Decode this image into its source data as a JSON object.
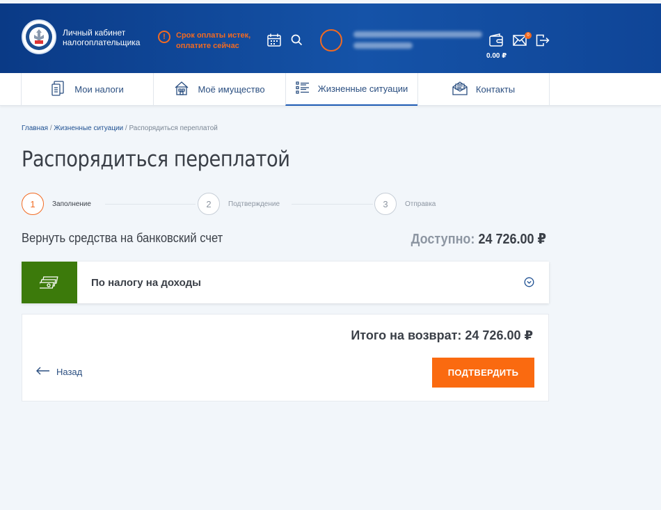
{
  "header": {
    "logo_title": "Личный кабинет налогоплательщика",
    "alert_text": "Срок оплаты истек, оплатите сейчас",
    "alert_icon": "!",
    "wallet_amount": "0.00 ₽",
    "mail_badge": "0"
  },
  "nav": {
    "items": [
      {
        "label": "Мои налоги",
        "icon": "tax-document-icon"
      },
      {
        "label": "Моё имущество",
        "icon": "property-house-icon"
      },
      {
        "label": "Жизненные ситуации",
        "icon": "list-icon",
        "active": true
      },
      {
        "label": "Контакты",
        "icon": "envelope-icon"
      }
    ]
  },
  "breadcrumb": {
    "home": "Главная",
    "situations": "Жизненные ситуации",
    "current": "Распорядиться переплатой",
    "sep": " / "
  },
  "page": {
    "title": "Распорядиться переплатой"
  },
  "steps": [
    {
      "num": "1",
      "label": "Заполнение",
      "active": true
    },
    {
      "num": "2",
      "label": "Подтверждение",
      "active": false
    },
    {
      "num": "3",
      "label": "Отправка",
      "active": false
    }
  ],
  "refund": {
    "section_title": "Вернуть средства на банковский счет",
    "available_label": "Доступно:",
    "available_value": "24 726.00 ₽",
    "tax_name": "По налогу на доходы",
    "total_text": "Итого на возврат: 24 726.00 ₽",
    "back_label": "Назад",
    "confirm_label": "ПОДТВЕРДИТЬ"
  },
  "colors": {
    "header_blue": "#1553a8",
    "accent_orange": "#fa6a10",
    "tax_green": "#3c7a0b"
  }
}
